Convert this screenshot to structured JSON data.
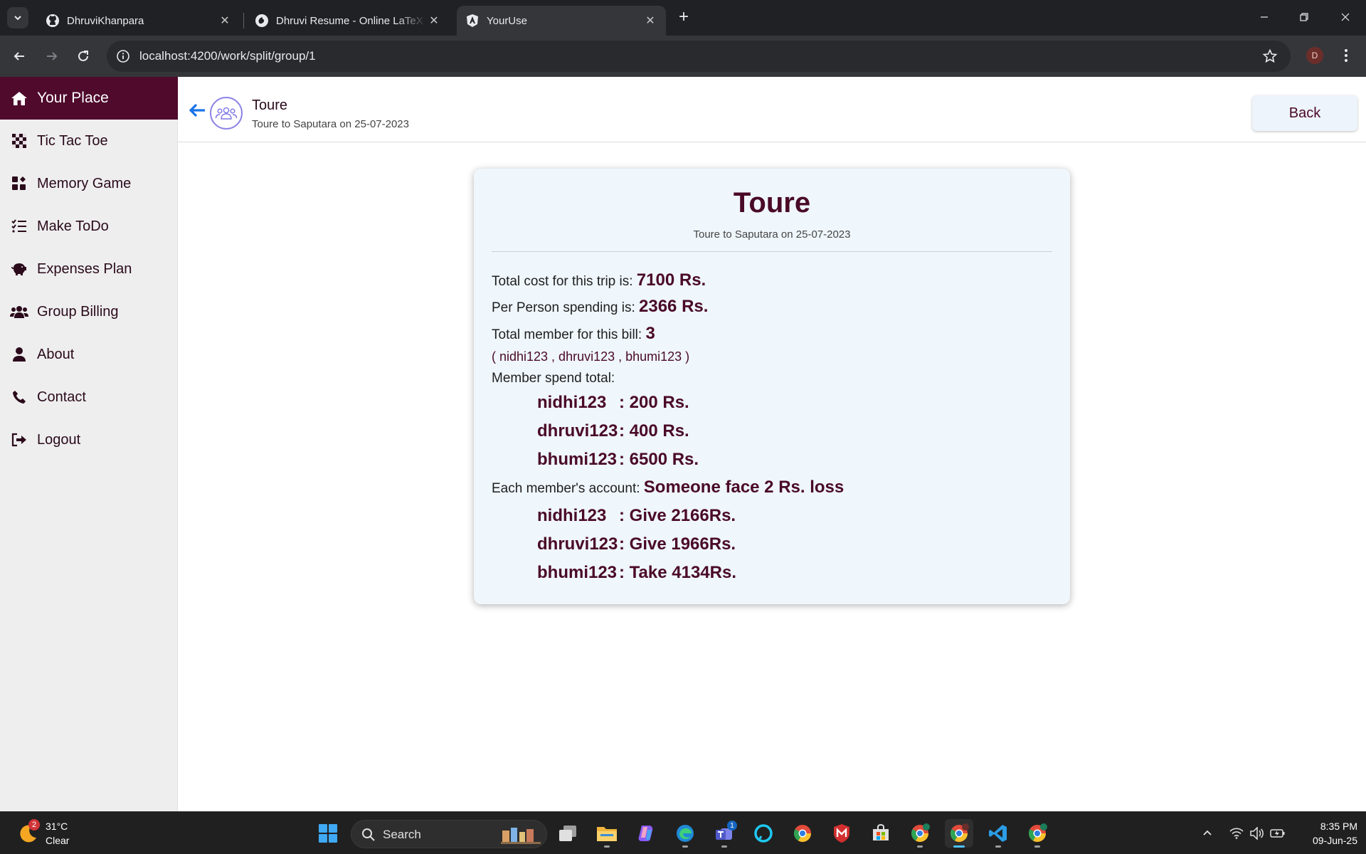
{
  "browser": {
    "tabs": [
      {
        "title": "DhruviKhanpara",
        "icon": "github-icon"
      },
      {
        "title": "Dhruvi Resume - Online LaTeX Editor",
        "icon": "overleaf-icon"
      },
      {
        "title": "YourUse",
        "icon": "angular-icon",
        "active": true
      }
    ],
    "url": "localhost:4200/work/split/group/1",
    "profile_initial": "D"
  },
  "sidebar": {
    "items": [
      {
        "label": "Your Place",
        "icon": "home-icon",
        "active": true
      },
      {
        "label": "Tic Tac Toe",
        "icon": "checkerboard-icon"
      },
      {
        "label": "Memory Game",
        "icon": "puzzle-icon"
      },
      {
        "label": "Make ToDo",
        "icon": "list-check-icon"
      },
      {
        "label": "Expenses Plan",
        "icon": "piggy-bank-icon"
      },
      {
        "label": "Group Billing",
        "icon": "users-icon"
      },
      {
        "label": "About",
        "icon": "person-icon"
      },
      {
        "label": "Contact",
        "icon": "phone-icon"
      },
      {
        "label": "Logout",
        "icon": "logout-icon"
      }
    ]
  },
  "header": {
    "title": "Toure",
    "subtitle": "Toure to Saputara on 25-07-2023",
    "back_label": "Back"
  },
  "card": {
    "title": "Toure",
    "subtitle": "Toure to Saputara on 25-07-2023",
    "total_cost_label": "Total cost for this trip is:",
    "total_cost_value": "7100 Rs.",
    "per_person_label": "Per Person spending is:",
    "per_person_value": "2366 Rs.",
    "member_count_label": "Total member for this bill:",
    "member_count_value": "3",
    "members_list": "( nidhi123 , dhruvi123 , bhumi123 )",
    "spend_label": "Member spend total:",
    "spend_rows": [
      {
        "name": "nidhi123",
        "value": ": 200 Rs."
      },
      {
        "name": "dhruvi123",
        "value": ": 400 Rs."
      },
      {
        "name": "bhumi123",
        "value": ": 6500 Rs."
      }
    ],
    "account_label": "Each member's account:",
    "account_value": "Someone face 2 Rs. loss",
    "account_rows": [
      {
        "name": "nidhi123",
        "value": ": Give 2166Rs."
      },
      {
        "name": "dhruvi123",
        "value": ": Give 1966Rs."
      },
      {
        "name": "bhumi123",
        "value": ": Take 4134Rs."
      }
    ]
  },
  "taskbar": {
    "weather_temp": "31°C",
    "weather_cond": "Clear",
    "weather_badge": "2",
    "search_label": "Search",
    "teams_badge": "1",
    "time": "8:35 PM",
    "date": "09-Jun-25"
  },
  "colors": {
    "brand": "#4f0a2c",
    "accent_text": "#4a0a27",
    "link_blue": "#1a73e8"
  }
}
